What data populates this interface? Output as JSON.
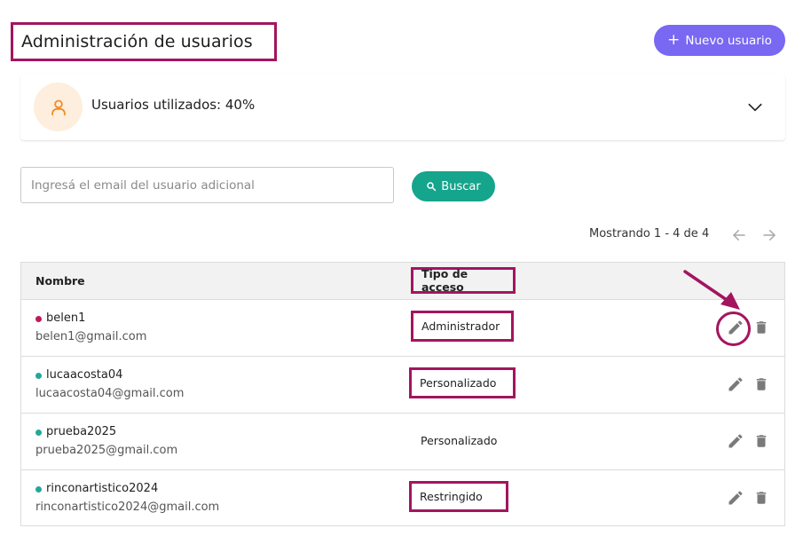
{
  "header": {
    "title": "Administración de usuarios",
    "new_user_label": "Nuevo usuario",
    "new_user_icon": "plus-icon"
  },
  "usage": {
    "icon": "user-icon",
    "text": "Usuarios utilizados: 40%",
    "expand_icon": "chevron-down-icon"
  },
  "search": {
    "placeholder": "Ingresá el email del usuario adicional",
    "value": "",
    "button_label": "Buscar",
    "button_icon": "search-icon"
  },
  "pagination": {
    "text": "Mostrando 1 - 4 de 4",
    "prev_icon": "arrow-left-icon",
    "next_icon": "arrow-right-icon"
  },
  "table": {
    "columns": [
      "Nombre",
      "Tipo de acceso"
    ],
    "rows": [
      {
        "username": "belen1",
        "email": "belen1@gmail.com",
        "access": "Administrador",
        "status_color": "#c2185b"
      },
      {
        "username": "lucaacosta04",
        "email": "lucaacosta04@gmail.com",
        "access": "Personalizado",
        "status_color": "#26a69a"
      },
      {
        "username": "prueba2025",
        "email": "prueba2025@gmail.com",
        "access": "Personalizado",
        "status_color": "#26a69a"
      },
      {
        "username": "rinconartistico2024",
        "email": "rinconartistico2024@gmail.com",
        "access": "Restringido",
        "status_color": "#26a69a"
      }
    ],
    "row_actions": [
      "pencil-icon",
      "trash-icon"
    ]
  },
  "colors": {
    "primary": "#7868f2",
    "success": "#15a48c",
    "annotation": "#a3155f",
    "avatar_bg": "#fdeede",
    "avatar_icon": "#f28c28",
    "icon_gray": "#7a7a7a"
  }
}
